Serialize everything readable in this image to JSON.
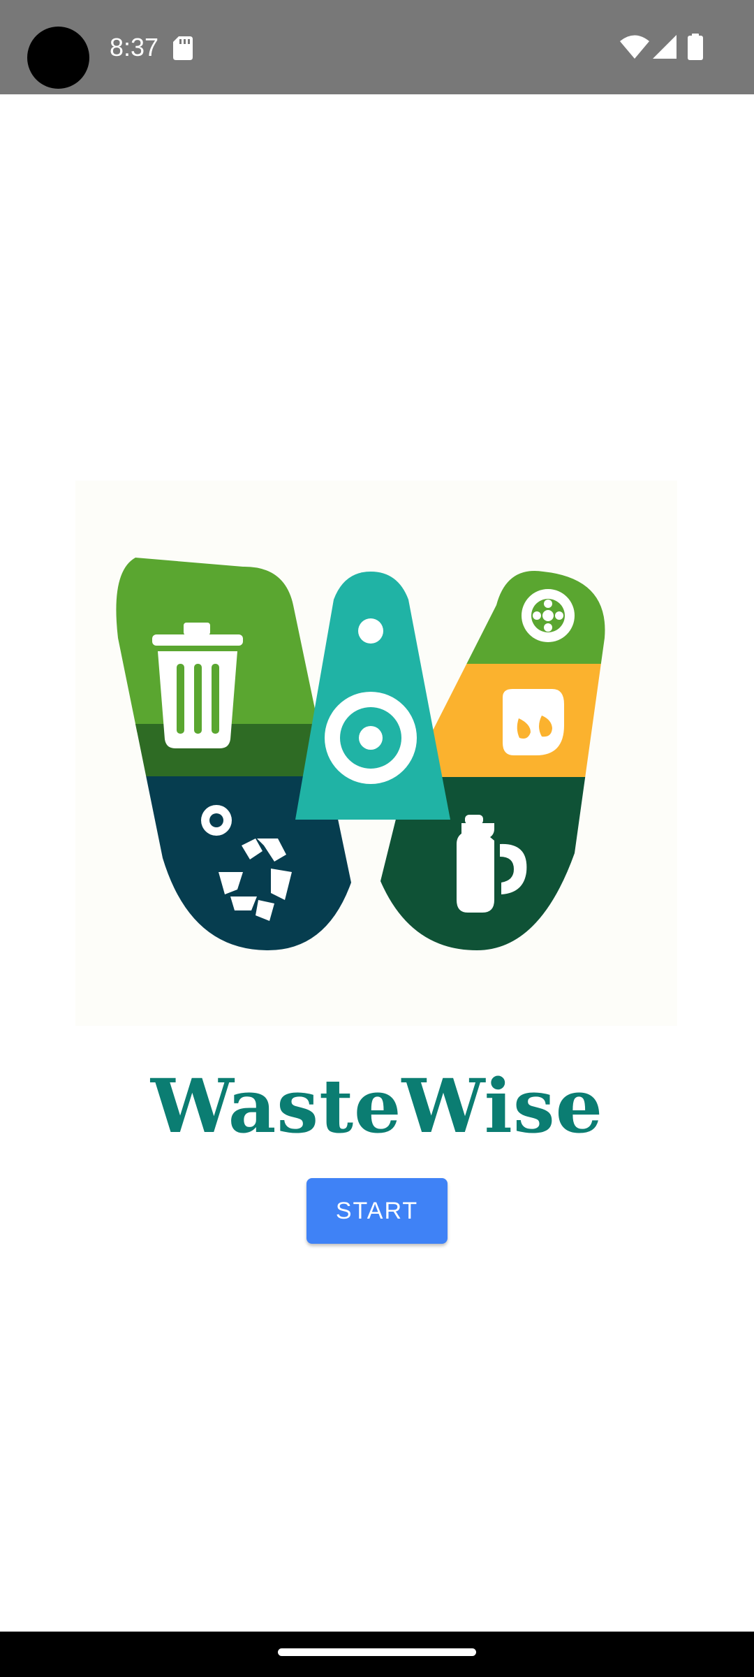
{
  "status_bar": {
    "time": "8:37",
    "icons": [
      "camera-cutout",
      "sd-card-icon",
      "wifi-icon",
      "cellular-signal-icon",
      "battery-icon"
    ]
  },
  "logo": {
    "icon": "wastewise-w-logo",
    "colors": {
      "lime_green": "#5aa630",
      "dark_green": "#2e6b24",
      "navy_teal": "#063d4f",
      "teal": "#20b3a5",
      "yellow": "#fbb22e",
      "forest_green": "#0f5236",
      "white": "#ffffff"
    }
  },
  "title": "WasteWise",
  "start_button": {
    "label": "START",
    "color": "#3f82f6"
  },
  "theme": {
    "title_color": "#0b7d72",
    "status_bar_color": "#787878",
    "nav_bar_color": "#000000"
  }
}
